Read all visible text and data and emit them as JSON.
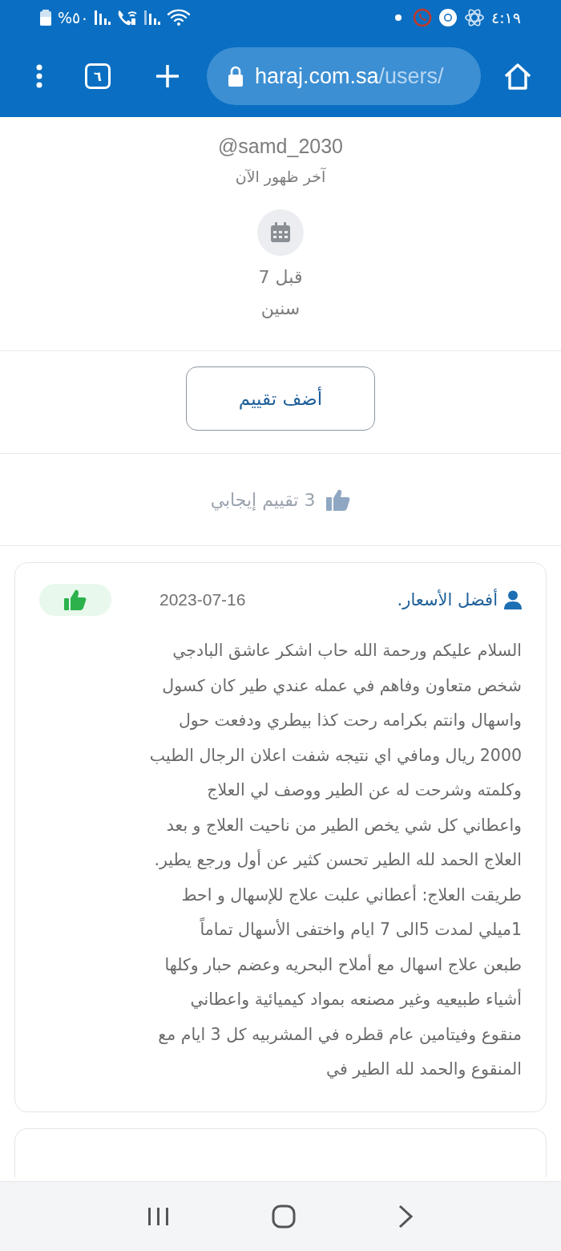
{
  "status_bar": {
    "battery": "%٥٠",
    "time": "٤:١٩"
  },
  "browser": {
    "tab_count": "٦",
    "url_host": "haraj.com.sa",
    "url_path": "/users/"
  },
  "profile": {
    "username": "@samd_2030",
    "last_seen": "آخر ظهور الآن",
    "member_since": "قبل 7",
    "member_since_unit": "سنين"
  },
  "add_review_button": "أضف تقييم",
  "rating_summary": "3 تقييم إيجابي",
  "reviews": [
    {
      "author": "أفضل الأسعار.",
      "date": "2023-07-16",
      "positive": true,
      "text": "السلام عليكم ورحمة الله حاب اشكر عاشق البادجي\nشخص متعاون وفاهم في عمله عندي طير كان كسول\nواسهال وانتم بكرامه رحت كذا بيطري ودفعت حول\n2000 ريال ومافي اي نتيجه شفت اعلان الرجال الطيب\nوكلمته وشرحت له عن الطير ووصف لي العلاج\nواعطاني كل شي يخص الطير من ناحيت العلاج و بعد\nالعلاج الحمد لله الطير تحسن كثير عن أول ورجع يطير.\nطريقت العلاج: أعطاني علبت علاج للإسهال و احط\n1ميلي لمدت 5الى 7 ايام واختفى الأسهال تماماً\nطبعن علاج اسهال مع أملاح البحريه وعضم حبار وكلها\nأشياء طبيعيه وغير مصنعه بمواد كيميائية واعطاني\nمنقوع وفيتامين عام قطره في المشربيه كل 3 ايام مع\nالمنقوع والحمد لله الطير في"
    }
  ]
}
